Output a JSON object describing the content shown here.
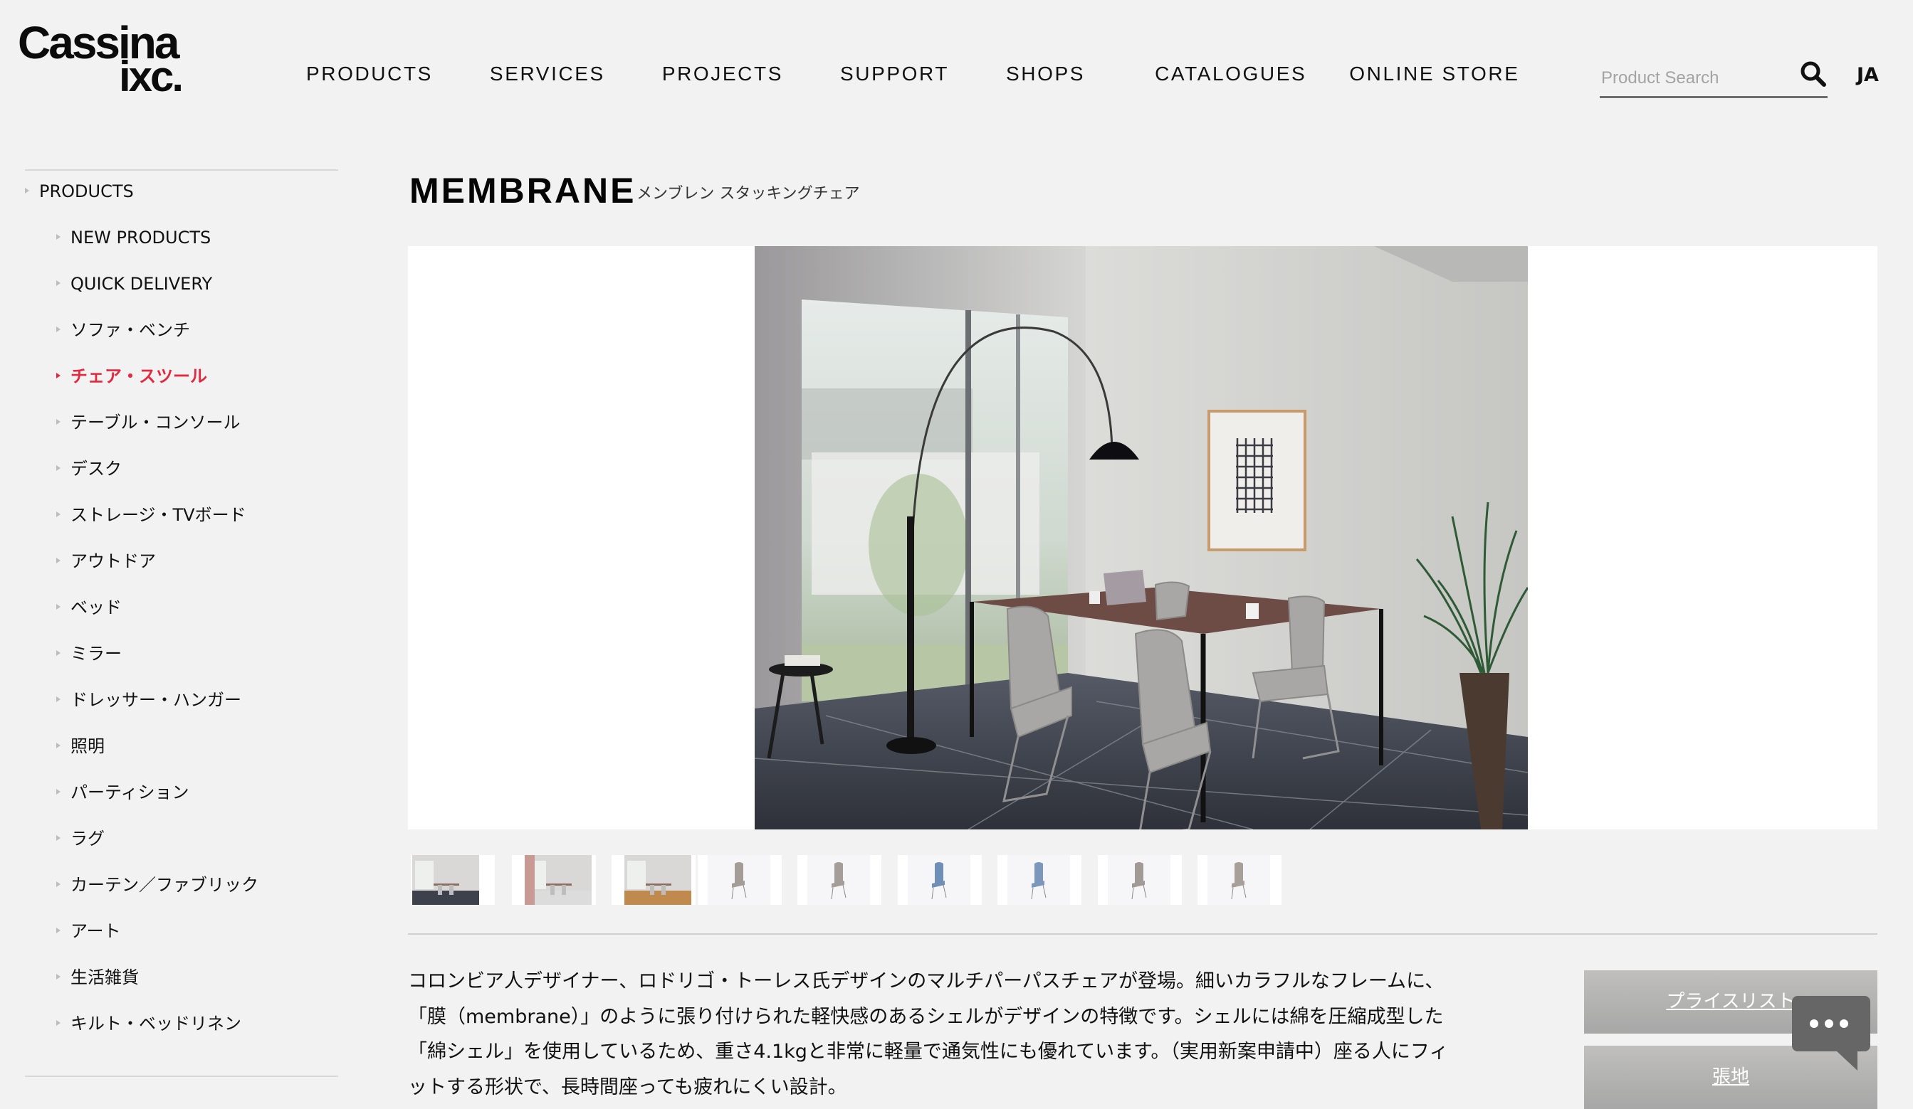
{
  "brand": {
    "logo_line1": "Cassina",
    "logo_line2": "ixc."
  },
  "nav": {
    "items": [
      {
        "label": "PRODUCTS"
      },
      {
        "label": "SERVICES"
      },
      {
        "label": "PROJECTS"
      },
      {
        "label": "SUPPORT"
      },
      {
        "label": "SHOPS"
      },
      {
        "label": "CATALOGUES"
      },
      {
        "label": "ONLINE STORE"
      }
    ]
  },
  "search": {
    "placeholder": "Product Search",
    "value": "",
    "icon": "search-icon"
  },
  "language": "JA",
  "sidebar": {
    "root": "PRODUCTS",
    "active_color": "#e2293f",
    "items": [
      {
        "label": "NEW PRODUCTS",
        "active": false
      },
      {
        "label": "QUICK DELIVERY",
        "active": false
      },
      {
        "label": "ソファ・ベンチ",
        "active": false
      },
      {
        "label": "チェア・スツール",
        "active": true
      },
      {
        "label": "テーブル・コンソール",
        "active": false
      },
      {
        "label": "デスク",
        "active": false
      },
      {
        "label": "ストレージ・TVボード",
        "active": false
      },
      {
        "label": "アウトドア",
        "active": false
      },
      {
        "label": "ベッド",
        "active": false
      },
      {
        "label": "ミラー",
        "active": false
      },
      {
        "label": "ドレッサー・ハンガー",
        "active": false
      },
      {
        "label": "照明",
        "active": false
      },
      {
        "label": "パーティション",
        "active": false
      },
      {
        "label": "ラグ",
        "active": false
      },
      {
        "label": "カーテン／ファブリック",
        "active": false
      },
      {
        "label": "アート",
        "active": false
      },
      {
        "label": "生活雑貨",
        "active": false
      },
      {
        "label": "キルト・ベッドリネン",
        "active": false
      }
    ]
  },
  "product": {
    "name": "MEMBRANE",
    "subtitle": "メンブレン スタッキングチェア",
    "main_image": "dining room scene with grey chairs, walnut table, arc floor lamp, framed grid print, potted plant",
    "thumbnails": [
      {
        "type": "scene",
        "desc": "dining room scene",
        "accent": "#c8a8a4"
      },
      {
        "type": "scene",
        "desc": "room with spiral staircase and round table",
        "accent": "#c99a94"
      },
      {
        "type": "scene",
        "desc": "room with wood floor and blue chairs",
        "accent": "#c08a4f"
      },
      {
        "type": "chair",
        "desc": "taupe chair sled base front",
        "color": "#a49d97"
      },
      {
        "type": "chair",
        "desc": "taupe chair sled base side",
        "color": "#a59e98"
      },
      {
        "type": "chair",
        "desc": "blue chair four legs front",
        "color": "#6f8fb8"
      },
      {
        "type": "chair",
        "desc": "blue chair four legs side",
        "color": "#7c97bc"
      },
      {
        "type": "chair",
        "desc": "taupe chair four legs front",
        "color": "#a29b95"
      },
      {
        "type": "chair",
        "desc": "taupe chair four legs side",
        "color": "#a7a09a"
      }
    ],
    "description_lines": [
      "コロンビア人デザイナー、ロドリゴ・トーレス氏デザインのマルチパーパスチェアが登場。細いカラフルなフレームに、",
      "「膜（membrane）」のように張り付けられた軽快感のあるシェルがデザインの特徴です。シェルには綿を圧縮成型した",
      "「綿シェル」を使用しているため、重さ4.1kgと非常に軽量で通気性にも優れています。（実用新案申請中）座る人にフィ",
      "ットする形状で、長時間座っても疲れにくい設計。"
    ]
  },
  "side_buttons": [
    {
      "label": "プライスリスト"
    },
    {
      "label": "張地"
    }
  ],
  "chat_widget": {
    "icon": "chat-bubble-icon"
  }
}
